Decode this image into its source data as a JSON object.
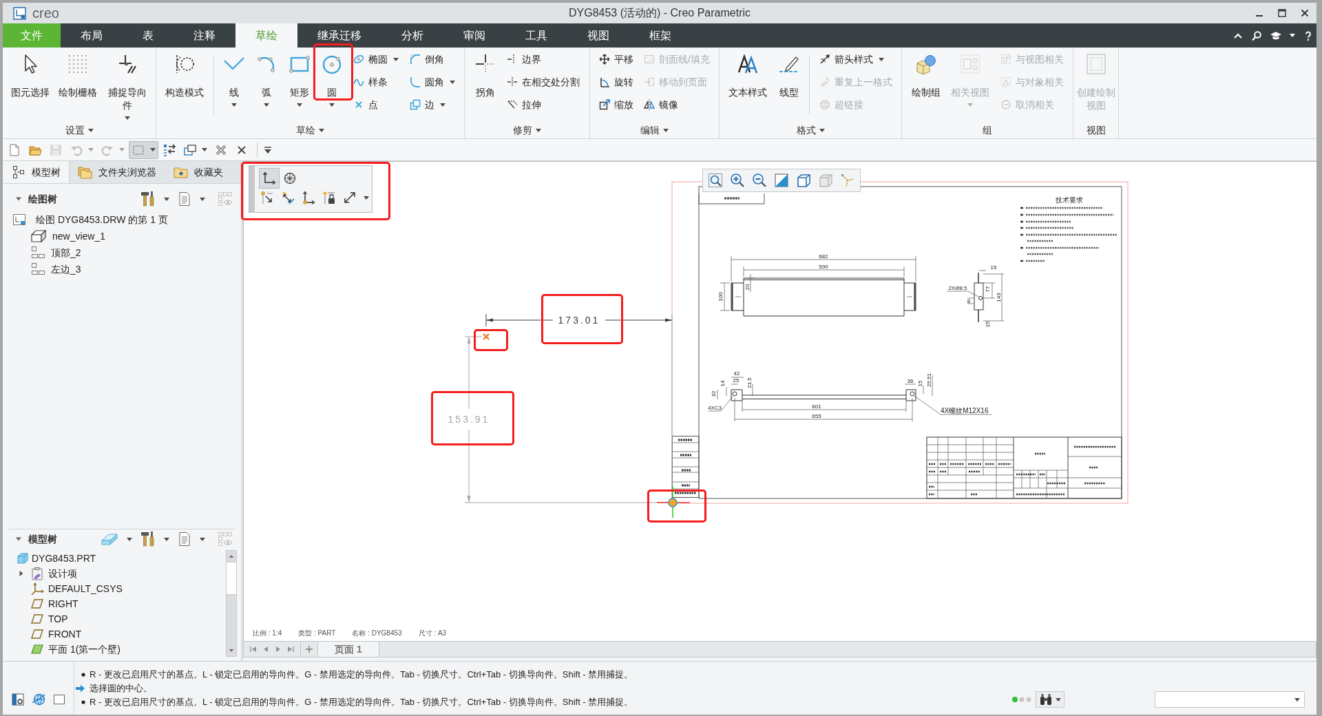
{
  "window": {
    "app_logo": "creo",
    "title": "DYG8453 (活动的) - Creo Parametric"
  },
  "ribbon_tabs": [
    {
      "label": "文件",
      "kind": "file",
      "selected": false
    },
    {
      "label": "布局",
      "kind": "tab",
      "selected": false
    },
    {
      "label": "表",
      "kind": "tab",
      "selected": false
    },
    {
      "label": "注释",
      "kind": "tab",
      "selected": false
    },
    {
      "label": "草绘",
      "kind": "tab",
      "selected": true
    },
    {
      "label": "继承迁移",
      "kind": "tab",
      "selected": false
    },
    {
      "label": "分析",
      "kind": "tab",
      "selected": false
    },
    {
      "label": "审阅",
      "kind": "tab",
      "selected": false
    },
    {
      "label": "工具",
      "kind": "tab",
      "selected": false
    },
    {
      "label": "视图",
      "kind": "tab",
      "selected": false
    },
    {
      "label": "框架",
      "kind": "tab",
      "selected": false
    }
  ],
  "ribbon_groups": [
    {
      "label": "设置",
      "dropdown": true,
      "columns": [
        [
          {
            "label": "图元选择",
            "kind": "large",
            "dropdown": false,
            "disabled": false
          }
        ],
        [
          {
            "label": "绘制栅格",
            "kind": "large",
            "dropdown": false,
            "disabled": false
          }
        ],
        [
          {
            "label": "捕捉导向件",
            "kind": "large",
            "dropdown": true,
            "disabled": false
          }
        ]
      ]
    },
    {
      "label": "草绘",
      "dropdown": true,
      "columns": [
        [
          {
            "label": "构造模式",
            "kind": "large",
            "dropdown": false,
            "disabled": false
          }
        ],
        [
          {
            "label": "线",
            "kind": "large",
            "dropdown": true,
            "disabled": false
          }
        ],
        [
          {
            "label": "弧",
            "kind": "large",
            "dropdown": true,
            "disabled": false
          }
        ],
        [
          {
            "label": "矩形",
            "kind": "large",
            "dropdown": true,
            "disabled": false
          }
        ],
        [
          {
            "label": "圆",
            "kind": "large",
            "dropdown": true,
            "disabled": false
          }
        ],
        [
          {
            "label": "椭圆",
            "kind": "small",
            "dropdown": true,
            "disabled": false
          },
          {
            "label": "样条",
            "kind": "small",
            "dropdown": false,
            "disabled": false
          },
          {
            "label": "点",
            "kind": "small",
            "dropdown": false,
            "disabled": false
          }
        ],
        [
          {
            "label": "倒角",
            "kind": "small",
            "dropdown": false,
            "disabled": false
          },
          {
            "label": "圆角",
            "kind": "small",
            "dropdown": true,
            "disabled": false
          },
          {
            "label": "边",
            "kind": "small",
            "dropdown": true,
            "disabled": false
          }
        ]
      ]
    },
    {
      "label": "修剪",
      "dropdown": true,
      "columns": [
        [
          {
            "label": "拐角",
            "kind": "large",
            "dropdown": false,
            "disabled": false
          }
        ],
        [
          {
            "label": "边界",
            "kind": "small",
            "dropdown": false,
            "disabled": false
          },
          {
            "label": "在相交处分割",
            "kind": "small",
            "dropdown": false,
            "disabled": false
          },
          {
            "label": "拉伸",
            "kind": "small",
            "dropdown": false,
            "disabled": false
          }
        ]
      ]
    },
    {
      "label": "编辑",
      "dropdown": true,
      "columns": [
        [
          {
            "label": "平移",
            "kind": "small",
            "dropdown": false,
            "disabled": false
          },
          {
            "label": "旋转",
            "kind": "small",
            "dropdown": false,
            "disabled": false
          },
          {
            "label": "缩放",
            "kind": "small",
            "dropdown": false,
            "disabled": false
          }
        ],
        [
          {
            "label": "剖面线/填充",
            "kind": "small",
            "dropdown": false,
            "disabled": true
          },
          {
            "label": "移动到页面",
            "kind": "small",
            "dropdown": false,
            "disabled": true
          },
          {
            "label": "镜像",
            "kind": "small",
            "dropdown": false,
            "disabled": false
          }
        ]
      ]
    },
    {
      "label": "格式",
      "dropdown": true,
      "columns": [
        [
          {
            "label": "文本样式",
            "kind": "large",
            "dropdown": false,
            "disabled": false
          }
        ],
        [
          {
            "label": "线型",
            "kind": "large",
            "dropdown": false,
            "disabled": false
          }
        ],
        [
          {
            "label": "箭头样式",
            "kind": "small",
            "dropdown": true,
            "disabled": false
          },
          {
            "label": "重复上一格式",
            "kind": "small",
            "dropdown": false,
            "disabled": true
          },
          {
            "label": "超链接",
            "kind": "small",
            "dropdown": false,
            "disabled": true
          }
        ]
      ]
    },
    {
      "label": "组",
      "dropdown": false,
      "columns": [
        [
          {
            "label": "绘制组",
            "kind": "large",
            "dropdown": false,
            "disabled": false
          }
        ],
        [
          {
            "label": "相关视图",
            "kind": "large",
            "dropdown": true,
            "disabled": true
          }
        ],
        [
          {
            "label": "与视图相关",
            "kind": "small",
            "dropdown": false,
            "disabled": true
          },
          {
            "label": "与对象相关",
            "kind": "small",
            "dropdown": false,
            "disabled": true
          },
          {
            "label": "取消相关",
            "kind": "small",
            "dropdown": false,
            "disabled": true
          }
        ]
      ]
    },
    {
      "label": "视图",
      "dropdown": false,
      "columns": [
        [
          {
            "label": "创建绘制视图",
            "kind": "large",
            "dropdown": false,
            "disabled": true
          }
        ]
      ]
    }
  ],
  "quick_access": [
    {
      "disabled": false,
      "pressed": false,
      "dropdown": false
    },
    {
      "disabled": false,
      "pressed": false,
      "dropdown": false
    },
    {
      "disabled": true,
      "pressed": false,
      "dropdown": false
    },
    {
      "disabled": true,
      "pressed": false,
      "dropdown": true
    },
    {
      "disabled": true,
      "pressed": false,
      "dropdown": true
    },
    {
      "disabled": false,
      "pressed": true,
      "dropdown": true
    },
    {
      "disabled": false,
      "pressed": false,
      "dropdown": false
    },
    {
      "disabled": false,
      "pressed": false,
      "dropdown": true
    },
    {
      "disabled": false,
      "pressed": false,
      "dropdown": false
    },
    {
      "disabled": false,
      "pressed": false,
      "dropdown": false
    }
  ],
  "left_panel": {
    "tabs": [
      {
        "label": "模型树",
        "selected": true
      },
      {
        "label": "文件夹浏览器",
        "selected": false
      },
      {
        "label": "收藏夹",
        "selected": false
      }
    ],
    "drawing_tree": {
      "title": "绘图树",
      "expanded": true,
      "items": [
        {
          "label": "绘图 DYG8453.DRW 的第 1 页",
          "kind": "sheet",
          "children": [
            {
              "label": "new_view_1",
              "kind": "general"
            },
            {
              "label": "顶部_2",
              "kind": "projection"
            },
            {
              "label": "左边_3",
              "kind": "projection"
            }
          ]
        }
      ]
    },
    "model_tree": {
      "title": "模型树",
      "expanded": true,
      "items": [
        {
          "label": "DYG8453.PRT",
          "kind": "part",
          "children": [
            {
              "label": "设计项",
              "kind": "folder",
              "expanded": false
            },
            {
              "label": "DEFAULT_CSYS",
              "kind": "csys"
            },
            {
              "label": "RIGHT",
              "kind": "plane"
            },
            {
              "label": "TOP",
              "kind": "plane"
            },
            {
              "label": "FRONT",
              "kind": "plane"
            },
            {
              "label": "平面 1(第一个壁)",
              "kind": "wall"
            }
          ]
        }
      ]
    }
  },
  "canvas": {
    "sketch_toolbar": [
      {
        "selected": true
      },
      {
        "selected": false
      }
    ],
    "sketch_dimensions": [
      {
        "value": "173.01",
        "kind": "horizontal",
        "dimmed": false
      },
      {
        "value": "153.91",
        "kind": "vertical",
        "dimmed": true
      }
    ],
    "drawing": {
      "notes_title": "技术要求",
      "front_view_dims": [
        "682",
        "590",
        "100",
        "20"
      ],
      "side_view_dims": [
        "15",
        "77",
        "143",
        "8",
        "15",
        "2XØ8.5"
      ],
      "bottom_view_dims": [
        "42",
        "25",
        "14",
        "32",
        "21.5",
        "36",
        "15",
        "25.51",
        "601",
        "655",
        "4XC3",
        "4X螺纹M12X16"
      ]
    },
    "info": [
      "比例 : 1:4",
      "类型 : PART",
      "名称 : DYG8453",
      "尺寸 : A3"
    ]
  },
  "page_tabs": [
    {
      "label": "页面 1",
      "selected": true
    }
  ],
  "status": {
    "messages": [
      {
        "kind": "bullet",
        "text": "R - 更改已启用尺寸的基点。L - 锁定已启用的导向件。G - 禁用选定的导向件。Tab - 切换尺寸。Ctrl+Tab - 切换导向件。Shift - 禁用捕捉。"
      },
      {
        "kind": "prompt",
        "text": "选择圆的中心。"
      },
      {
        "kind": "bullet",
        "text": "R - 更改已启用尺寸的基点。L - 锁定已启用的导向件。G - 禁用选定的导向件。Tab - 切换尺寸。Ctrl+Tab - 切换导向件。Shift - 禁用捕捉。"
      }
    ]
  }
}
